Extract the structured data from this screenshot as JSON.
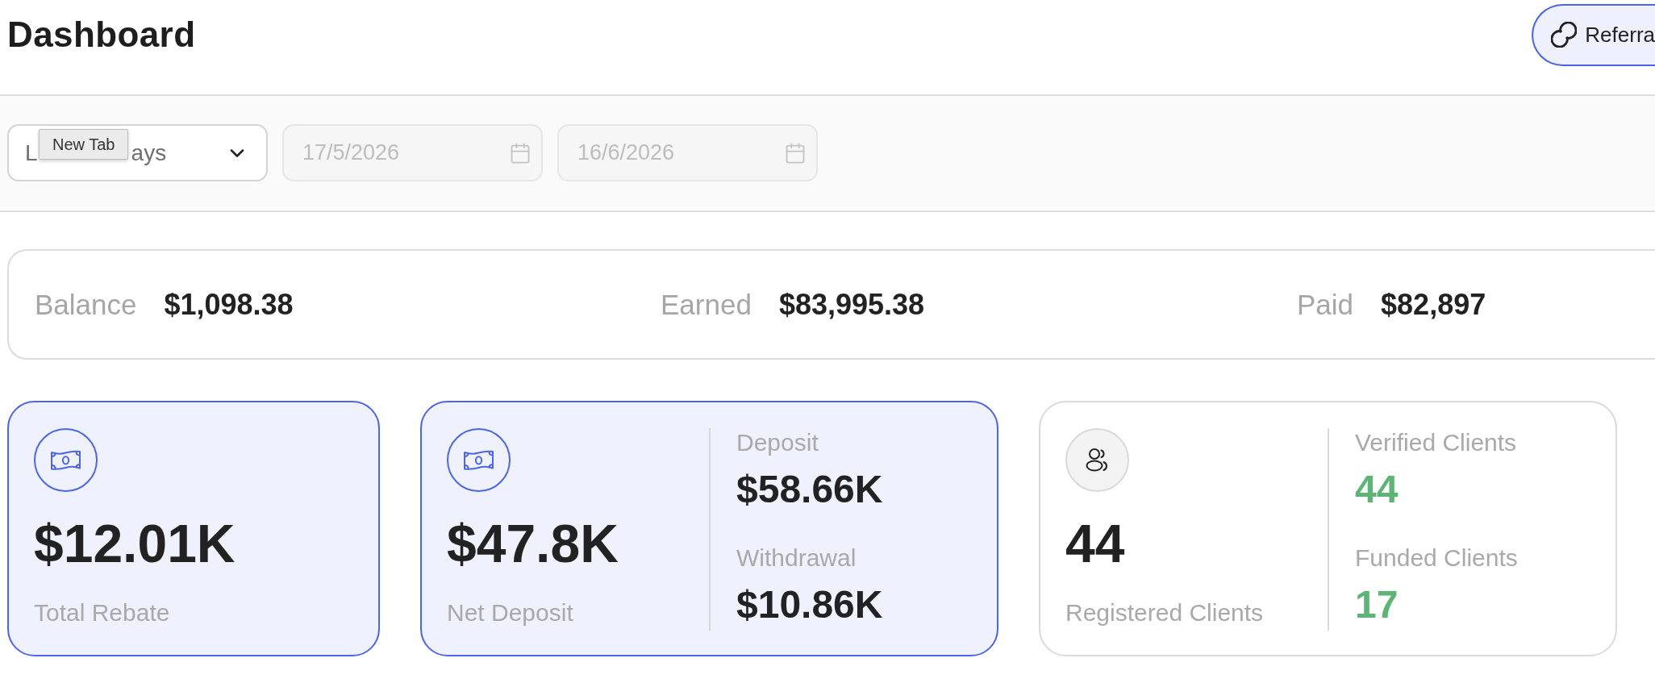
{
  "header": {
    "title": "Dashboard",
    "referral_button": {
      "label": "Referra"
    }
  },
  "filters": {
    "period_select": {
      "visible_text": [
        "L",
        "ays"
      ]
    },
    "tooltip": "New Tab",
    "date_fields": [
      {
        "value": "17/5/2026",
        "disabled": true
      },
      {
        "value": "16/6/2026",
        "disabled": true
      }
    ]
  },
  "summary": [
    {
      "label": "Balance",
      "value": "$1,098.38"
    },
    {
      "label": "Earned",
      "value": "$83,995.38"
    },
    {
      "label": "Paid",
      "value": "$82,897"
    }
  ],
  "stat_cards": [
    {
      "kind": "amount",
      "highlighted": true,
      "value": "$12.01K",
      "label": "Total Rebate"
    },
    {
      "kind": "amount",
      "highlighted": true,
      "value": "$47.8K",
      "label": "Net Deposit",
      "breakdown": [
        {
          "label": "Deposit",
          "value": "$58.66K"
        },
        {
          "label": "Withdrawal",
          "value": "$10.86K"
        }
      ]
    },
    {
      "kind": "count",
      "highlighted": false,
      "value": "44",
      "label": "Registered Clients",
      "breakdown": [
        {
          "label": "Verified Clients",
          "value": "44"
        },
        {
          "label": "Funded Clients",
          "value": "17"
        }
      ]
    }
  ]
}
